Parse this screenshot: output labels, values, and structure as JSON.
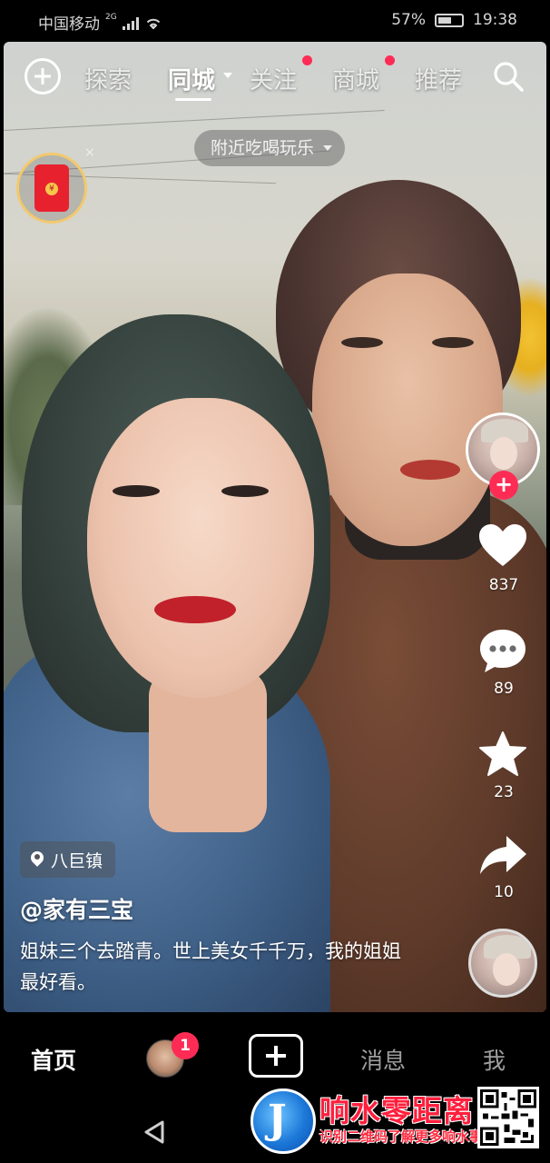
{
  "status_bar": {
    "carrier": "中国移动",
    "network": "2G",
    "battery": "57%",
    "time": "19:38"
  },
  "top_nav": {
    "tabs": [
      {
        "label": "探索",
        "active": false
      },
      {
        "label": "同城",
        "active": true
      },
      {
        "label": "关注",
        "active": false,
        "dot": true
      },
      {
        "label": "商城",
        "active": false,
        "dot": true
      },
      {
        "label": "推荐",
        "active": false
      }
    ],
    "icons": [
      "plus-circle-icon",
      "search-icon"
    ]
  },
  "filter_chip": {
    "label": "附近吃喝玩乐"
  },
  "red_packet": {
    "close": "×",
    "icon": "red-envelope-icon"
  },
  "video": {
    "location": "八巨镇",
    "author": "@家有三宝",
    "description": "姐妹三个去踏青。世上美女千千万，我的姐姐最好看。"
  },
  "actions": {
    "likes": "837",
    "comments": "89",
    "favorites": "23",
    "shares": "10",
    "icons": [
      "heart-icon",
      "comment-icon",
      "star-icon",
      "share-icon"
    ]
  },
  "bottom_nav": {
    "home": "首页",
    "friends_badge": "1",
    "messages": "消息",
    "me": "我"
  },
  "watermark": {
    "logo_glyph": "J",
    "title": "响水零距离",
    "subtitle": "识别二维码了解更多响水事"
  },
  "colors": {
    "accent": "#fe2c55",
    "background": "#000000",
    "watermark_red": "#ff1f3d"
  }
}
